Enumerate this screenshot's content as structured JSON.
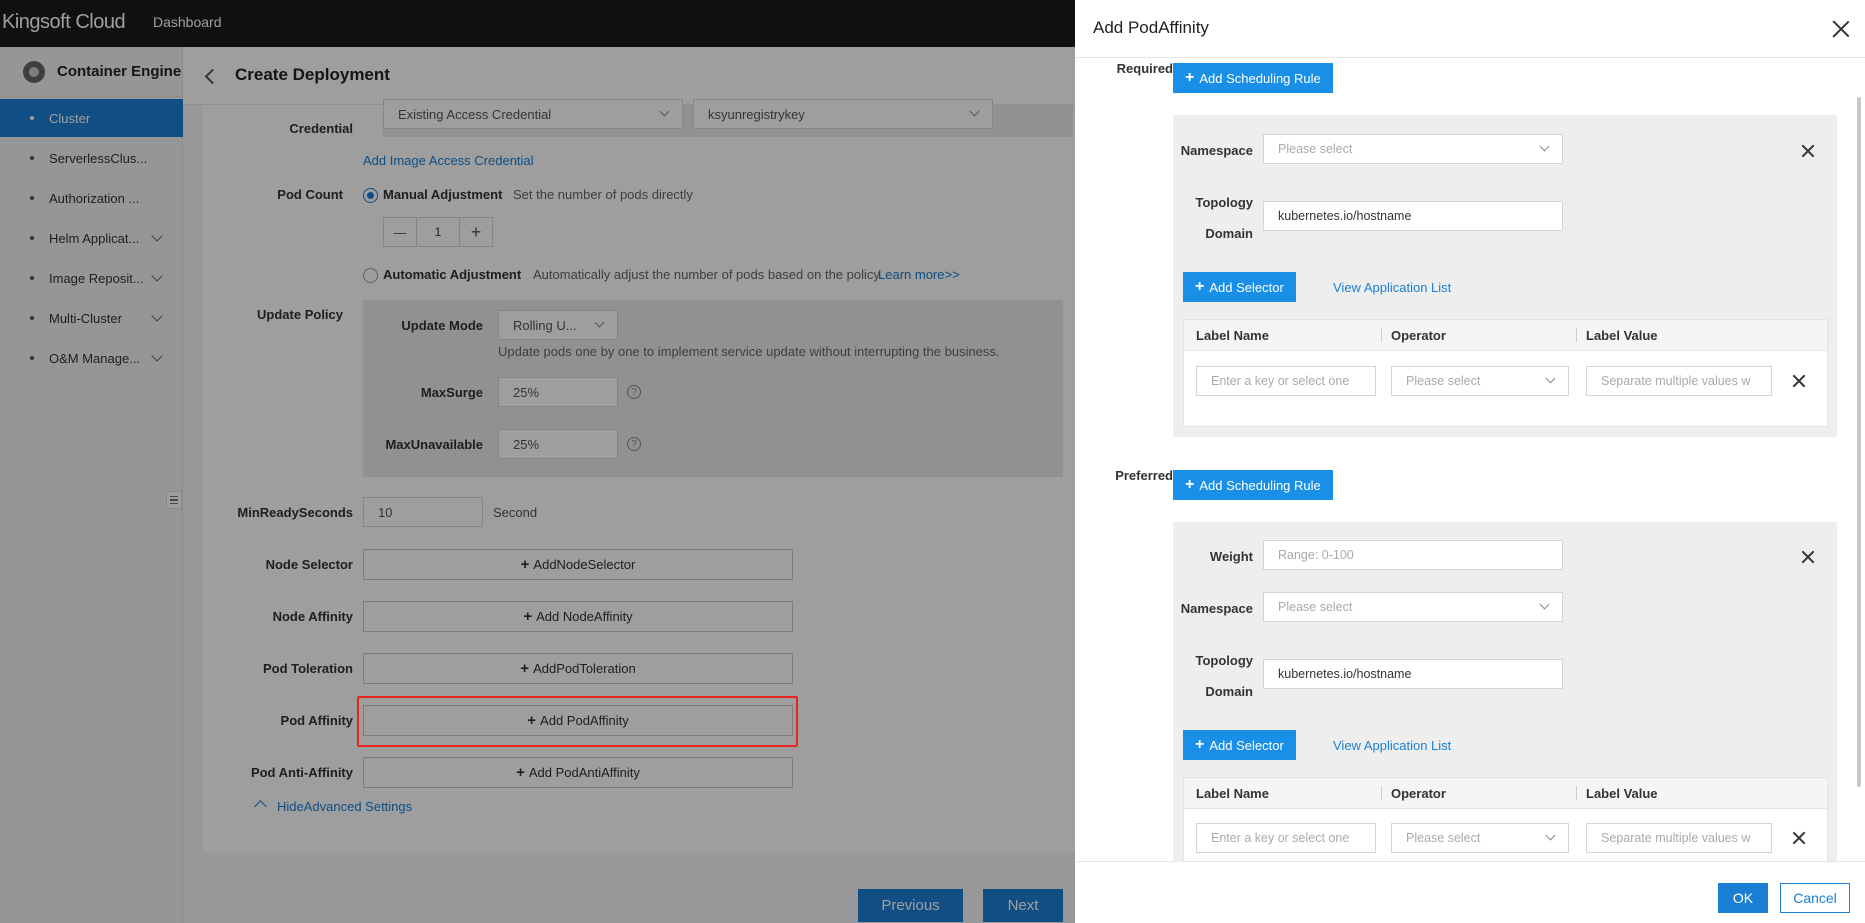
{
  "app": {
    "logo": "Kingsoft Cloud",
    "top_nav": "Dashboard"
  },
  "sidebar": {
    "product": "Container Engine",
    "items": [
      {
        "label": "Cluster",
        "active": true,
        "has_chevron": false
      },
      {
        "label": "ServerlessClus...",
        "active": false,
        "has_chevron": false
      },
      {
        "label": "Authorization ...",
        "active": false,
        "has_chevron": false
      },
      {
        "label": "Helm Applicat...",
        "active": false,
        "has_chevron": true
      },
      {
        "label": "Image Reposit...",
        "active": false,
        "has_chevron": true
      },
      {
        "label": "Multi-Cluster",
        "active": false,
        "has_chevron": true
      },
      {
        "label": "O&M Manage...",
        "active": false,
        "has_chevron": true
      }
    ]
  },
  "page": {
    "title": "Create Deployment"
  },
  "form": {
    "credential": {
      "label": "Credential",
      "type_value": "Existing Access Credential",
      "secret_value": "ksyunregistrykey",
      "add_link": "Add Image Access Credential"
    },
    "pod_count": {
      "label": "Pod Count",
      "manual_label": "Manual Adjustment",
      "manual_hint": "Set the number of pods directly",
      "stepper_minus": "—",
      "stepper_value": "1",
      "stepper_plus": "+",
      "auto_label": "Automatic Adjustment",
      "auto_hint": "Automatically adjust the number of pods based on the policy.",
      "learn_more": "Learn more>>"
    },
    "update_policy": {
      "label": "Update Policy",
      "mode_label": "Update Mode",
      "mode_value": "Rolling U...",
      "mode_hint": "Update pods one by one to implement service update without interrupting the business.",
      "max_surge_label": "MaxSurge",
      "max_surge_value": "25%",
      "max_unavailable_label": "MaxUnavailable",
      "max_unavailable_value": "25%",
      "help": "?"
    },
    "min_ready": {
      "label": "MinReadySeconds",
      "value": "10",
      "unit": "Second"
    },
    "node_selector": {
      "label": "Node Selector",
      "button": "AddNodeSelector"
    },
    "node_affinity": {
      "label": "Node Affinity",
      "button": "Add NodeAffinity"
    },
    "pod_toleration": {
      "label": "Pod Toleration",
      "button": "AddPodToleration"
    },
    "pod_affinity": {
      "label": "Pod Affinity",
      "button": "Add PodAffinity"
    },
    "pod_anti_affinity": {
      "label": "Pod Anti-Affinity",
      "button": "Add PodAntiAffinity"
    },
    "hide_advanced": "HideAdvanced Settings",
    "plus_glyph": "+"
  },
  "footer": {
    "previous": "Previous",
    "next": "Next"
  },
  "drawer": {
    "title": "Add PodAffinity",
    "required": {
      "label": "Required",
      "add_rule": "Add Scheduling Rule",
      "namespace_label": "Namespace",
      "namespace_placeholder": "Please select",
      "topology_label_1": "Topology",
      "topology_label_2": "Domain",
      "topology_value": "kubernetes.io/hostname",
      "add_selector": "Add Selector",
      "view_apps": "View Application List",
      "col_label_name": "Label Name",
      "col_operator": "Operator",
      "col_label_value": "Label Value",
      "key_placeholder": "Enter a key or select one",
      "operator_placeholder": "Please select",
      "value_placeholder": "Separate multiple values w"
    },
    "preferred": {
      "label": "Preferred",
      "add_rule": "Add Scheduling Rule",
      "weight_label": "Weight",
      "weight_placeholder": "Range: 0-100",
      "namespace_label": "Namespace",
      "namespace_placeholder": "Please select",
      "topology_label_1": "Topology",
      "topology_label_2": "Domain",
      "topology_value": "kubernetes.io/hostname",
      "add_selector": "Add Selector",
      "view_apps": "View Application List",
      "col_label_name": "Label Name",
      "col_operator": "Operator",
      "col_label_value": "Label Value",
      "key_placeholder": "Enter a key or select one",
      "operator_placeholder": "Please select",
      "value_placeholder": "Separate multiple values w"
    },
    "ok": "OK",
    "cancel": "Cancel"
  },
  "colors": {
    "accent": "#1a7fd4",
    "highlight": "#e8251c",
    "overlay": "rgba(0,0,0,0.38)"
  }
}
